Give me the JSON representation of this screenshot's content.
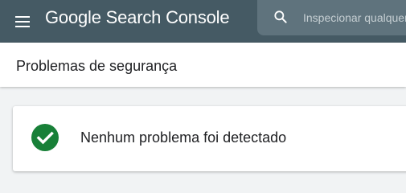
{
  "app": {
    "title": "Google Search Console",
    "topbar_color": "#455a64"
  },
  "menu": {
    "icon": "hamburger-menu-icon"
  },
  "search": {
    "icon": "search-icon",
    "placeholder": "Inspecionar qualquer URL em"
  },
  "page": {
    "title": "Problemas de segurança"
  },
  "status": {
    "icon": "check-circle-icon",
    "icon_color": "#188038",
    "message": "Nenhum problema foi detectado"
  }
}
